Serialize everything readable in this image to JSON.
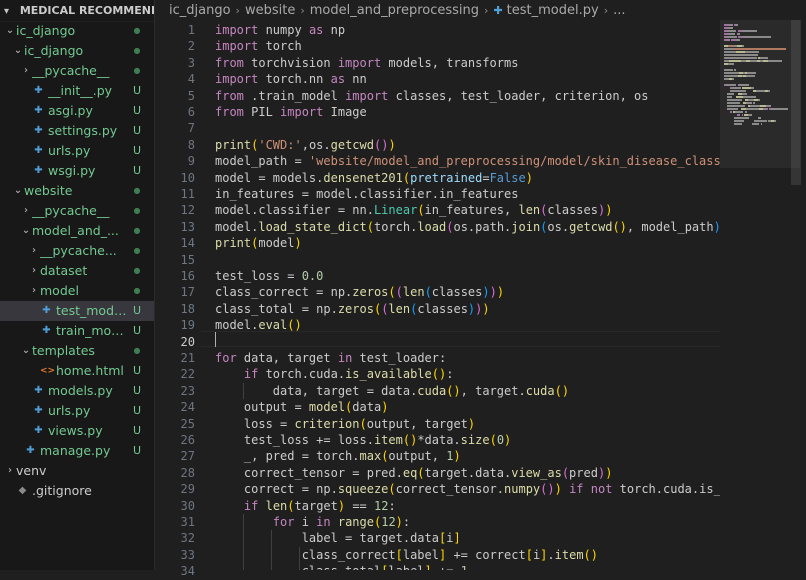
{
  "explorer": {
    "title": "MEDICAL RECOMMENDATION",
    "items": [
      {
        "label": "ic_django",
        "type": "folder",
        "open": true,
        "depth": 1,
        "status": "dot"
      },
      {
        "label": "ic_django",
        "type": "folder",
        "open": true,
        "depth": 2,
        "status": "dot"
      },
      {
        "label": "__pycache__",
        "type": "folder",
        "open": false,
        "depth": 3,
        "status": "dot"
      },
      {
        "label": "__init__.py",
        "type": "py",
        "depth": 3,
        "status": "U"
      },
      {
        "label": "asgi.py",
        "type": "py",
        "depth": 3,
        "status": "U"
      },
      {
        "label": "settings.py",
        "type": "py",
        "depth": 3,
        "status": "U"
      },
      {
        "label": "urls.py",
        "type": "py",
        "depth": 3,
        "status": "U"
      },
      {
        "label": "wsgi.py",
        "type": "py",
        "depth": 3,
        "status": "U"
      },
      {
        "label": "website",
        "type": "folder",
        "open": true,
        "depth": 2,
        "status": "dot"
      },
      {
        "label": "__pycache__",
        "type": "folder",
        "open": false,
        "depth": 3,
        "status": "dot"
      },
      {
        "label": "model_and_...",
        "type": "folder",
        "open": true,
        "depth": 3,
        "status": "dot"
      },
      {
        "label": "__pycache...",
        "type": "folder",
        "open": false,
        "depth": 4,
        "status": "dot"
      },
      {
        "label": "dataset",
        "type": "folder",
        "open": false,
        "depth": 4,
        "status": "dot"
      },
      {
        "label": "model",
        "type": "folder",
        "open": false,
        "depth": 4,
        "status": "dot"
      },
      {
        "label": "test_model...",
        "type": "py",
        "depth": 4,
        "status": "U",
        "active": true
      },
      {
        "label": "train_mode...",
        "type": "py",
        "depth": 4,
        "status": "U"
      },
      {
        "label": "templates",
        "type": "folder",
        "open": true,
        "depth": 3,
        "status": "dot"
      },
      {
        "label": "home.html",
        "type": "html",
        "depth": 4,
        "status": "U"
      },
      {
        "label": "models.py",
        "type": "py",
        "depth": 3,
        "status": "U"
      },
      {
        "label": "urls.py",
        "type": "py",
        "depth": 3,
        "status": "U"
      },
      {
        "label": "views.py",
        "type": "py",
        "depth": 3,
        "status": "U"
      },
      {
        "label": "manage.py",
        "type": "py",
        "depth": 2,
        "status": "U"
      },
      {
        "label": "venv",
        "type": "folder",
        "open": false,
        "depth": 1,
        "status": ""
      },
      {
        "label": ".gitignore",
        "type": "git",
        "depth": 1,
        "status": ""
      }
    ]
  },
  "breadcrumbs": [
    "ic_django",
    "website",
    "model_and_preprocessing",
    "test_model.py",
    "..."
  ],
  "editor": {
    "current_line": 20,
    "lines": [
      [
        [
          "kw",
          "import"
        ],
        [
          "tok",
          " numpy "
        ],
        [
          "kw",
          "as"
        ],
        [
          "tok",
          " np"
        ]
      ],
      [
        [
          "kw",
          "import"
        ],
        [
          "tok",
          " torch"
        ]
      ],
      [
        [
          "kw",
          "from"
        ],
        [
          "tok",
          " torchvision "
        ],
        [
          "kw",
          "import"
        ],
        [
          "tok",
          " models, transforms"
        ]
      ],
      [
        [
          "kw",
          "import"
        ],
        [
          "tok",
          " torch.nn "
        ],
        [
          "kw",
          "as"
        ],
        [
          "tok",
          " nn"
        ]
      ],
      [
        [
          "kw",
          "from"
        ],
        [
          "tok",
          " .train_model "
        ],
        [
          "kw",
          "import"
        ],
        [
          "tok",
          " classes, test_loader, criterion, os"
        ]
      ],
      [
        [
          "kw",
          "from"
        ],
        [
          "tok",
          " PIL "
        ],
        [
          "kw",
          "import"
        ],
        [
          "tok",
          " Image"
        ]
      ],
      [],
      [
        [
          "fn",
          "print"
        ],
        [
          "b1",
          "("
        ],
        [
          "str",
          "'CWD:'"
        ],
        [
          "tok",
          ",os."
        ],
        [
          "fn",
          "getcwd"
        ],
        [
          "b2",
          "()"
        ],
        [
          "b1",
          ")"
        ]
      ],
      [
        [
          "tok",
          "model_path = "
        ],
        [
          "str",
          "'website/model_and_preprocessing/model/skin_disease_classificati"
        ]
      ],
      [
        [
          "tok",
          "model = models."
        ],
        [
          "fn",
          "densenet201"
        ],
        [
          "b1",
          "("
        ],
        [
          "param",
          "pretrained"
        ],
        [
          "tok",
          "="
        ],
        [
          "const",
          "False"
        ],
        [
          "b1",
          ")"
        ]
      ],
      [
        [
          "tok",
          "in_features = model.classifier.in_features"
        ]
      ],
      [
        [
          "tok",
          "model.classifier = nn."
        ],
        [
          "cls",
          "Linear"
        ],
        [
          "b1",
          "("
        ],
        [
          "tok",
          "in_features, "
        ],
        [
          "fn",
          "len"
        ],
        [
          "b2",
          "("
        ],
        [
          "tok",
          "classes"
        ],
        [
          "b2",
          ")"
        ],
        [
          "b1",
          ")"
        ]
      ],
      [
        [
          "tok",
          "model."
        ],
        [
          "fn",
          "load_state_dict"
        ],
        [
          "b1",
          "("
        ],
        [
          "tok",
          "torch."
        ],
        [
          "fn",
          "load"
        ],
        [
          "b2",
          "("
        ],
        [
          "tok",
          "os.path."
        ],
        [
          "fn",
          "join"
        ],
        [
          "b3",
          "("
        ],
        [
          "tok",
          "os."
        ],
        [
          "fn",
          "getcwd"
        ],
        [
          "b1",
          "()"
        ],
        [
          "tok",
          ", model_path"
        ],
        [
          "b3",
          ")"
        ],
        [
          "b2",
          ")"
        ],
        [
          "b1",
          ")"
        ]
      ],
      [
        [
          "fn",
          "print"
        ],
        [
          "b1",
          "("
        ],
        [
          "tok",
          "model"
        ],
        [
          "b1",
          ")"
        ]
      ],
      [],
      [
        [
          "tok",
          "test_loss = "
        ],
        [
          "num",
          "0.0"
        ]
      ],
      [
        [
          "tok",
          "class_correct = np."
        ],
        [
          "fn",
          "zeros"
        ],
        [
          "b1",
          "("
        ],
        [
          "b2",
          "("
        ],
        [
          "fn",
          "len"
        ],
        [
          "b3",
          "("
        ],
        [
          "tok",
          "classes"
        ],
        [
          "b3",
          ")"
        ],
        [
          "b2",
          ")"
        ],
        [
          "b1",
          ")"
        ]
      ],
      [
        [
          "tok",
          "class_total = np."
        ],
        [
          "fn",
          "zeros"
        ],
        [
          "b1",
          "("
        ],
        [
          "b2",
          "("
        ],
        [
          "fn",
          "len"
        ],
        [
          "b3",
          "("
        ],
        [
          "tok",
          "classes"
        ],
        [
          "b3",
          ")"
        ],
        [
          "b2",
          ")"
        ],
        [
          "b1",
          ")"
        ]
      ],
      [
        [
          "tok",
          "model."
        ],
        [
          "fn",
          "eval"
        ],
        [
          "b1",
          "()"
        ]
      ],
      [],
      [
        [
          "kw",
          "for"
        ],
        [
          "tok",
          " data, target "
        ],
        [
          "kw",
          "in"
        ],
        [
          "tok",
          " test_loader:"
        ]
      ],
      [
        [
          "tok",
          "    "
        ],
        [
          "kw",
          "if"
        ],
        [
          "tok",
          " torch.cuda."
        ],
        [
          "fn",
          "is_available"
        ],
        [
          "b1",
          "()"
        ],
        [
          "tok",
          ":"
        ]
      ],
      [
        [
          "tok",
          "        data, target = data."
        ],
        [
          "fn",
          "cuda"
        ],
        [
          "b1",
          "()"
        ],
        [
          "tok",
          ", target."
        ],
        [
          "fn",
          "cuda"
        ],
        [
          "b1",
          "()"
        ]
      ],
      [
        [
          "tok",
          "    output = "
        ],
        [
          "fn",
          "model"
        ],
        [
          "b1",
          "("
        ],
        [
          "tok",
          "data"
        ],
        [
          "b1",
          ")"
        ]
      ],
      [
        [
          "tok",
          "    loss = "
        ],
        [
          "fn",
          "criterion"
        ],
        [
          "b1",
          "("
        ],
        [
          "tok",
          "output, target"
        ],
        [
          "b1",
          ")"
        ]
      ],
      [
        [
          "tok",
          "    test_loss += loss."
        ],
        [
          "fn",
          "item"
        ],
        [
          "b1",
          "()"
        ],
        [
          "tok",
          "*data."
        ],
        [
          "fn",
          "size"
        ],
        [
          "b1",
          "("
        ],
        [
          "num",
          "0"
        ],
        [
          "b1",
          ")"
        ]
      ],
      [
        [
          "tok",
          "    _, pred = torch."
        ],
        [
          "fn",
          "max"
        ],
        [
          "b1",
          "("
        ],
        [
          "tok",
          "output, "
        ],
        [
          "num",
          "1"
        ],
        [
          "b1",
          ")"
        ]
      ],
      [
        [
          "tok",
          "    correct_tensor = pred."
        ],
        [
          "fn",
          "eq"
        ],
        [
          "b1",
          "("
        ],
        [
          "tok",
          "target.data."
        ],
        [
          "fn",
          "view_as"
        ],
        [
          "b2",
          "("
        ],
        [
          "tok",
          "pred"
        ],
        [
          "b2",
          ")"
        ],
        [
          "b1",
          ")"
        ]
      ],
      [
        [
          "tok",
          "    correct = np."
        ],
        [
          "fn",
          "squeeze"
        ],
        [
          "b1",
          "("
        ],
        [
          "tok",
          "correct_tensor."
        ],
        [
          "fn",
          "numpy"
        ],
        [
          "b2",
          "()"
        ],
        [
          "b1",
          ")"
        ],
        [
          "tok",
          " "
        ],
        [
          "kw",
          "if"
        ],
        [
          "tok",
          " "
        ],
        [
          "kw",
          "not"
        ],
        [
          "tok",
          " torch.cuda.is_availab"
        ]
      ],
      [
        [
          "tok",
          "    "
        ],
        [
          "kw",
          "if"
        ],
        [
          "tok",
          " "
        ],
        [
          "fn",
          "len"
        ],
        [
          "b1",
          "("
        ],
        [
          "tok",
          "target"
        ],
        [
          "b1",
          ")"
        ],
        [
          "tok",
          " == "
        ],
        [
          "num",
          "12"
        ],
        [
          "tok",
          ":"
        ]
      ],
      [
        [
          "tok",
          "        "
        ],
        [
          "kw",
          "for"
        ],
        [
          "tok",
          " i "
        ],
        [
          "kw",
          "in"
        ],
        [
          "tok",
          " "
        ],
        [
          "fn",
          "range"
        ],
        [
          "b1",
          "("
        ],
        [
          "num",
          "12"
        ],
        [
          "b1",
          ")"
        ],
        [
          "tok",
          ":"
        ]
      ],
      [
        [
          "tok",
          "            label = target.data"
        ],
        [
          "b1",
          "["
        ],
        [
          "tok",
          "i"
        ],
        [
          "b1",
          "]"
        ]
      ],
      [
        [
          "tok",
          "            class_correct"
        ],
        [
          "b1",
          "["
        ],
        [
          "tok",
          "label"
        ],
        [
          "b1",
          "]"
        ],
        [
          "tok",
          " += correct"
        ],
        [
          "b1",
          "["
        ],
        [
          "tok",
          "i"
        ],
        [
          "b1",
          "]"
        ],
        [
          "tok",
          "."
        ],
        [
          "fn",
          "item"
        ],
        [
          "b1",
          "()"
        ]
      ],
      [
        [
          "tok",
          "            class_total"
        ],
        [
          "b1",
          "["
        ],
        [
          "tok",
          "label"
        ],
        [
          "b1",
          "]"
        ],
        [
          "tok",
          " += "
        ],
        [
          "num",
          "1"
        ]
      ]
    ]
  },
  "colors": {
    "bg": "#1f1f1f",
    "sidebar": "#181818",
    "keyword": "#c586c0",
    "function": "#dcdcaa",
    "string": "#ce9178",
    "number": "#b5cea8",
    "class": "#4ec9b0",
    "untracked": "#73c991"
  }
}
